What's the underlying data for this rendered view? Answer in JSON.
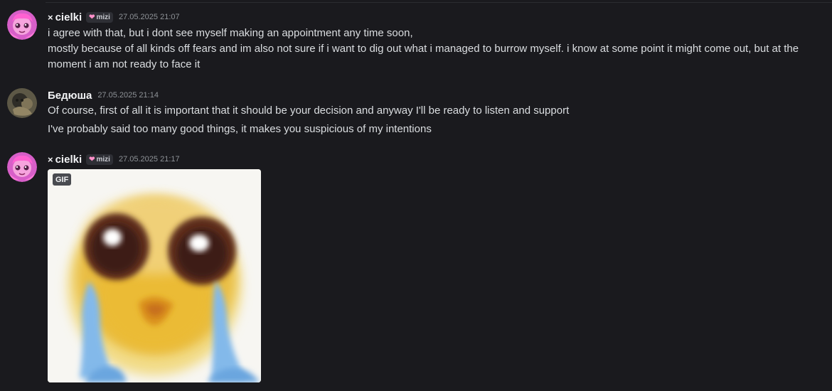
{
  "messages": [
    {
      "author_prefix": "×",
      "author": "cielki",
      "role_tag": {
        "icon": "heart-icon",
        "label": "mizi",
        "color": "#ff8fc9"
      },
      "timestamp": "27.05.2025 21:07",
      "lines": [
        "i agree with that, but i dont see myself making an appointment any time soon,",
        "mostly because of all kinds off fears and im also not sure if i want to dig out what i managed to burrow myself. i know at some point it might come out, but at the",
        "moment i am not ready to face it"
      ]
    },
    {
      "author": "Бедюша",
      "timestamp": "27.05.2025 21:14",
      "lines": [
        "Of course, first of all it is important that it should be your decision and anyway I'll be ready to listen and support",
        "I've probably said too many good things, it makes you suspicious of my intentions"
      ]
    },
    {
      "author_prefix": "×",
      "author": "cielki",
      "role_tag": {
        "icon": "heart-icon",
        "label": "mizi",
        "color": "#ff8fc9"
      },
      "timestamp": "27.05.2025 21:17",
      "attachment": {
        "badge": "GIF",
        "kind": "crying-emoji-gif"
      }
    }
  ],
  "colors": {
    "background": "#1a1a1e",
    "text": "#dbdee1",
    "muted": "#8e9297"
  }
}
